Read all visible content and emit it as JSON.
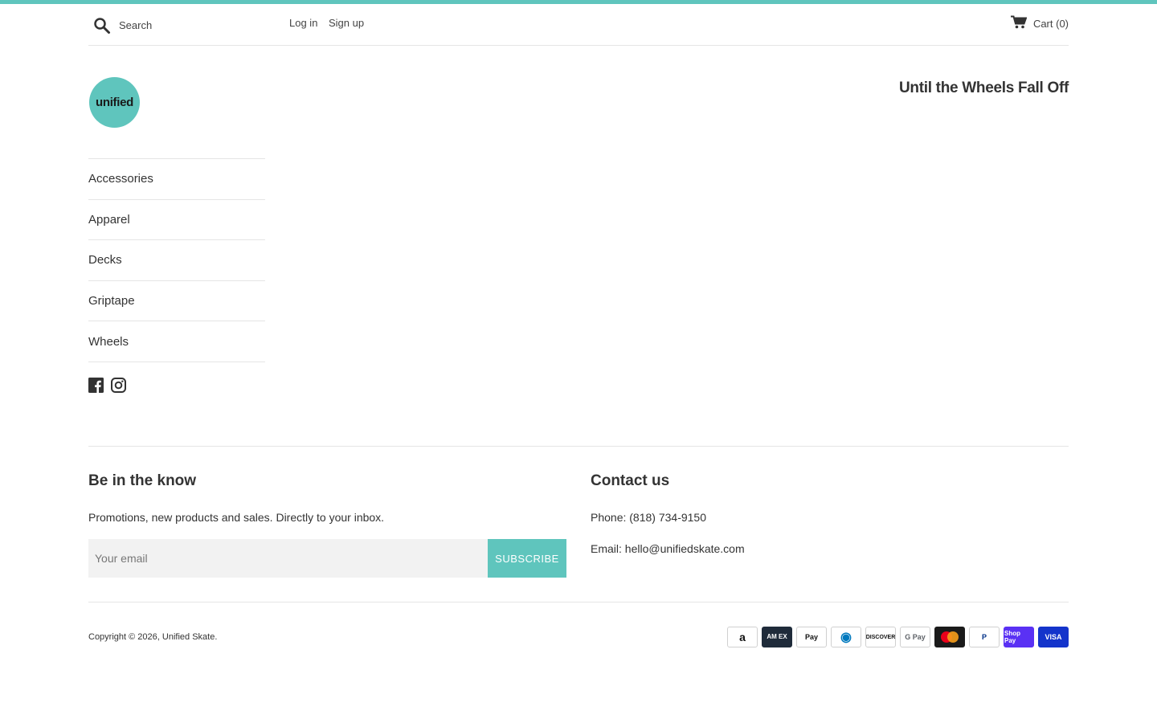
{
  "colors": {
    "accent": "#5fc5bd"
  },
  "header": {
    "search_placeholder": "Search",
    "login": "Log in",
    "signup": "Sign up",
    "cart": "Cart (0)"
  },
  "brand": {
    "logo_text": "unified",
    "tagline": "Until the Wheels Fall Off"
  },
  "sidebar": {
    "items": [
      {
        "label": "Accessories"
      },
      {
        "label": "Apparel"
      },
      {
        "label": "Decks"
      },
      {
        "label": "Griptape"
      },
      {
        "label": "Wheels"
      }
    ]
  },
  "social": [
    "facebook-icon",
    "instagram-icon"
  ],
  "footer": {
    "newsletter": {
      "heading": "Be in the know",
      "text": "Promotions, new products and sales. Directly to your inbox.",
      "placeholder": "Your email",
      "button": "SUBSCRIBE"
    },
    "contact": {
      "heading": "Contact us",
      "phone": "Phone: (818) 734-9150",
      "email": "Email: hello@unifiedskate.com"
    },
    "copyright_prefix": "Copyright © 2026, ",
    "copyright_link": "Unified Skate",
    "copyright_suffix": "."
  },
  "payments": [
    {
      "name": "amazon",
      "label": "a",
      "bg": "#ffffff",
      "fg": "#111111"
    },
    {
      "name": "american-express",
      "label": "AM EX",
      "bg": "#1f2b3a",
      "fg": "#ffffff"
    },
    {
      "name": "apple-pay",
      "label": " Pay",
      "bg": "#ffffff",
      "fg": "#111111"
    },
    {
      "name": "diners-club",
      "label": "◉",
      "bg": "#ffffff",
      "fg": "#0079be"
    },
    {
      "name": "discover",
      "label": "DISCOVER",
      "bg": "#ffffff",
      "fg": "#111111"
    },
    {
      "name": "google-pay",
      "label": "G Pay",
      "bg": "#ffffff",
      "fg": "#5f6368"
    },
    {
      "name": "mastercard",
      "label": "",
      "bg": "#1a1a1a",
      "fg": "#ffffff"
    },
    {
      "name": "paypal",
      "label": "P",
      "bg": "#ffffff",
      "fg": "#003087"
    },
    {
      "name": "shop-pay",
      "label": "Shop Pay",
      "bg": "#5a31f4",
      "fg": "#ffffff"
    },
    {
      "name": "visa",
      "label": "VISA",
      "bg": "#1434cb",
      "fg": "#ffffff"
    }
  ]
}
